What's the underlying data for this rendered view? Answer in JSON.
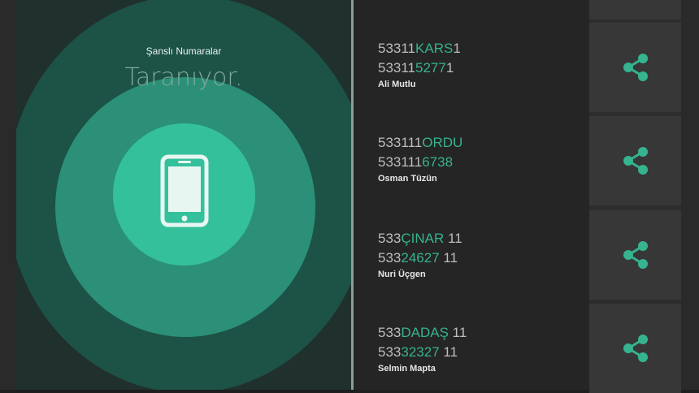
{
  "left": {
    "title": "Şanslı Numaralar",
    "scan_text": "Taranıyor.",
    "center_icon": "smartphone-icon",
    "colors": {
      "ring_outer": "#1d5246",
      "ring_mid": "#2b9077",
      "ring_inner": "#35c09c"
    }
  },
  "entries": [
    {
      "line1": {
        "prefix": "53311",
        "highlight": "KARS",
        "suffix": "1"
      },
      "line2": {
        "prefix": "53311",
        "highlight": "5277",
        "suffix": "1"
      },
      "name": "Ali Mutlu"
    },
    {
      "line1": {
        "prefix": "533111",
        "highlight": "ORDU",
        "suffix": ""
      },
      "line2": {
        "prefix": "533111",
        "highlight": "6738",
        "suffix": ""
      },
      "name": "Osman Tüzün"
    },
    {
      "line1": {
        "prefix": "533",
        "highlight": "ÇINAR",
        "suffix": " 11"
      },
      "line2": {
        "prefix": "533",
        "highlight": "24627",
        "suffix": " 11"
      },
      "name": "Nuri Üçgen"
    },
    {
      "line1": {
        "prefix": "533",
        "highlight": "DADAŞ",
        "suffix": " 11"
      },
      "line2": {
        "prefix": "533",
        "highlight": "32327",
        "suffix": " 11"
      },
      "name": "Selmin Mapta"
    }
  ],
  "share_icon": "share-icon",
  "accent": "#36b38f"
}
